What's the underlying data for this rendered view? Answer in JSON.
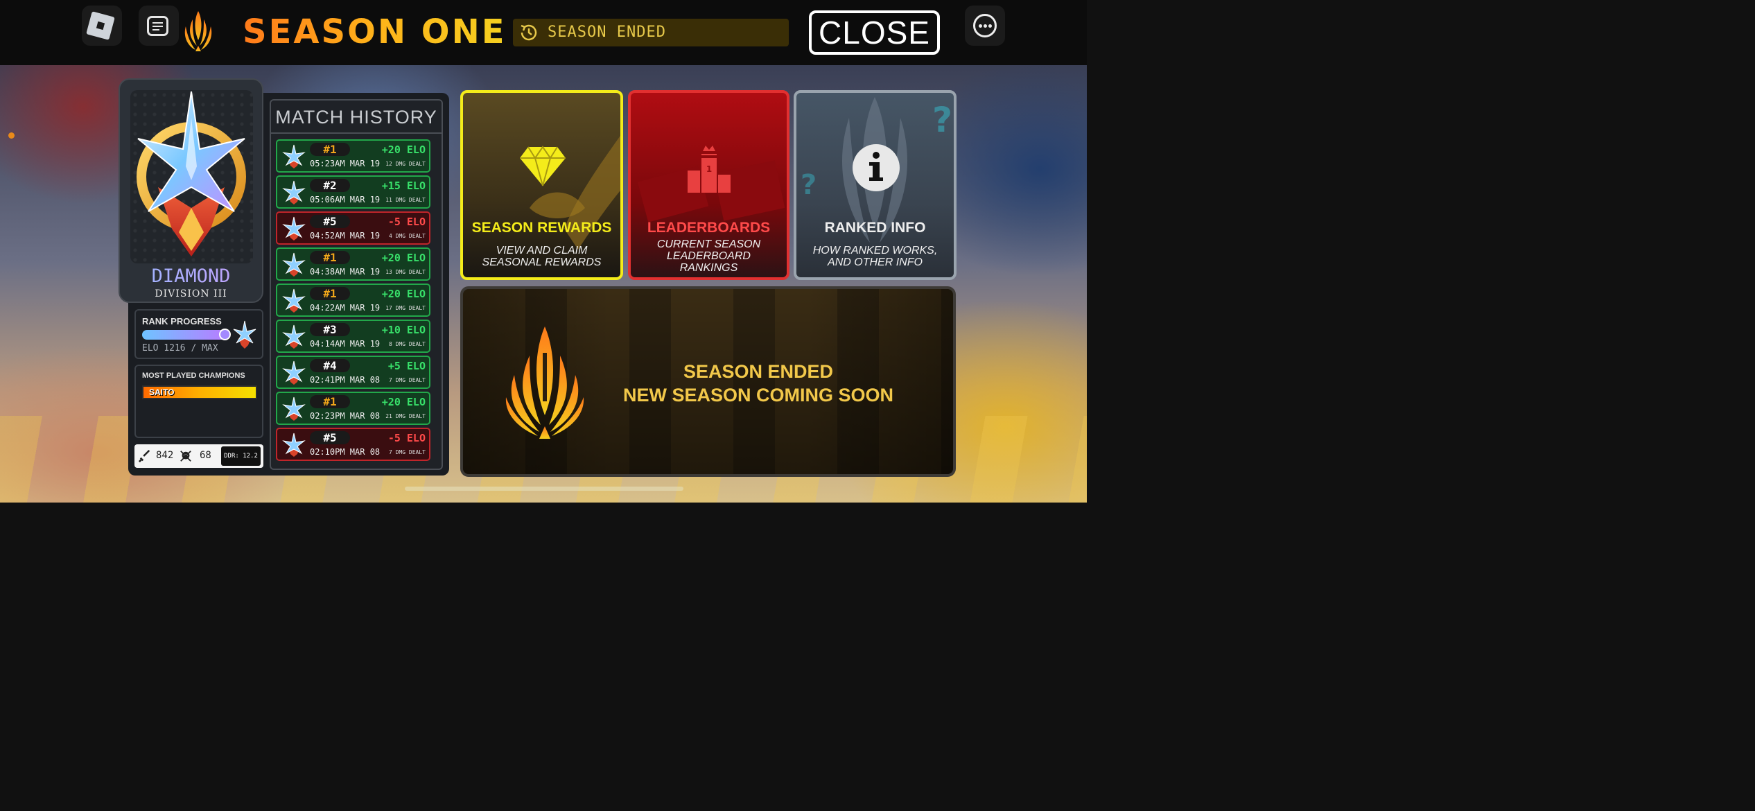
{
  "header": {
    "title": "SEASON ONE",
    "status": "SEASON ENDED",
    "close_label": "CLOSE",
    "icons": [
      "roblox-menu-icon",
      "chat-icon",
      "season-logo-icon",
      "clock-icon",
      "more-options-icon"
    ]
  },
  "rank": {
    "tier": "DIAMOND",
    "division": "DIVISION III",
    "progress_label": "RANK PROGRESS",
    "progress_fraction": 1.0,
    "elo_text": "ELO 1216 / MAX"
  },
  "champions": {
    "label": "MOST PLAYED CHAMPIONS",
    "items": [
      "SAITO"
    ]
  },
  "stats": {
    "damage": "842",
    "kills": "68",
    "ddr": "DDR: 12.2"
  },
  "match_history": {
    "title": "MATCH HISTORY",
    "matches": [
      {
        "place": "#1",
        "time": "05:23AM MAR 19",
        "elo": "+20 ELO",
        "dmg": "12 DMG DEALT",
        "result": "win"
      },
      {
        "place": "#2",
        "time": "05:06AM MAR 19",
        "elo": "+15 ELO",
        "dmg": "11 DMG DEALT",
        "result": "win"
      },
      {
        "place": "#5",
        "time": "04:52AM MAR 19",
        "elo": "-5 ELO",
        "dmg": "4 DMG DEALT",
        "result": "loss"
      },
      {
        "place": "#1",
        "time": "04:38AM MAR 19",
        "elo": "+20 ELO",
        "dmg": "13 DMG DEALT",
        "result": "win"
      },
      {
        "place": "#1",
        "time": "04:22AM MAR 19",
        "elo": "+20 ELO",
        "dmg": "17 DMG DEALT",
        "result": "win"
      },
      {
        "place": "#3",
        "time": "04:14AM MAR 19",
        "elo": "+10 ELO",
        "dmg": "8 DMG DEALT",
        "result": "win"
      },
      {
        "place": "#4",
        "time": "02:41PM MAR 08",
        "elo": "+5 ELO",
        "dmg": "7 DMG DEALT",
        "result": "win"
      },
      {
        "place": "#1",
        "time": "02:23PM MAR 08",
        "elo": "+20 ELO",
        "dmg": "21 DMG DEALT",
        "result": "win"
      },
      {
        "place": "#5",
        "time": "02:10PM MAR 08",
        "elo": "-5 ELO",
        "dmg": "7 DMG DEALT",
        "result": "loss"
      }
    ]
  },
  "tiles": [
    {
      "title": "SEASON REWARDS",
      "subtitle": "VIEW AND CLAIM SEASONAL REWARDS",
      "title_color": "#f4ec1a",
      "icon": "diamond-icon"
    },
    {
      "title": "LEADERBOARDS",
      "subtitle": "CURRENT SEASON LEADERBOARD RANKINGS",
      "title_color": "#ff4a4a",
      "icon": "podium-icon"
    },
    {
      "title": "RANKED INFO",
      "subtitle": "HOW RANKED WORKS, AND OTHER INFO",
      "title_color": "#eeeeee",
      "icon": "info-icon"
    }
  ],
  "banner": {
    "line1": "SEASON ENDED",
    "line2": "NEW SEASON COMING SOON"
  },
  "colors": {
    "accent_orange": "#ff7a1a",
    "accent_yellow": "#f5d020",
    "win_green": "#38e06a",
    "loss_red": "#ff4a4a"
  }
}
